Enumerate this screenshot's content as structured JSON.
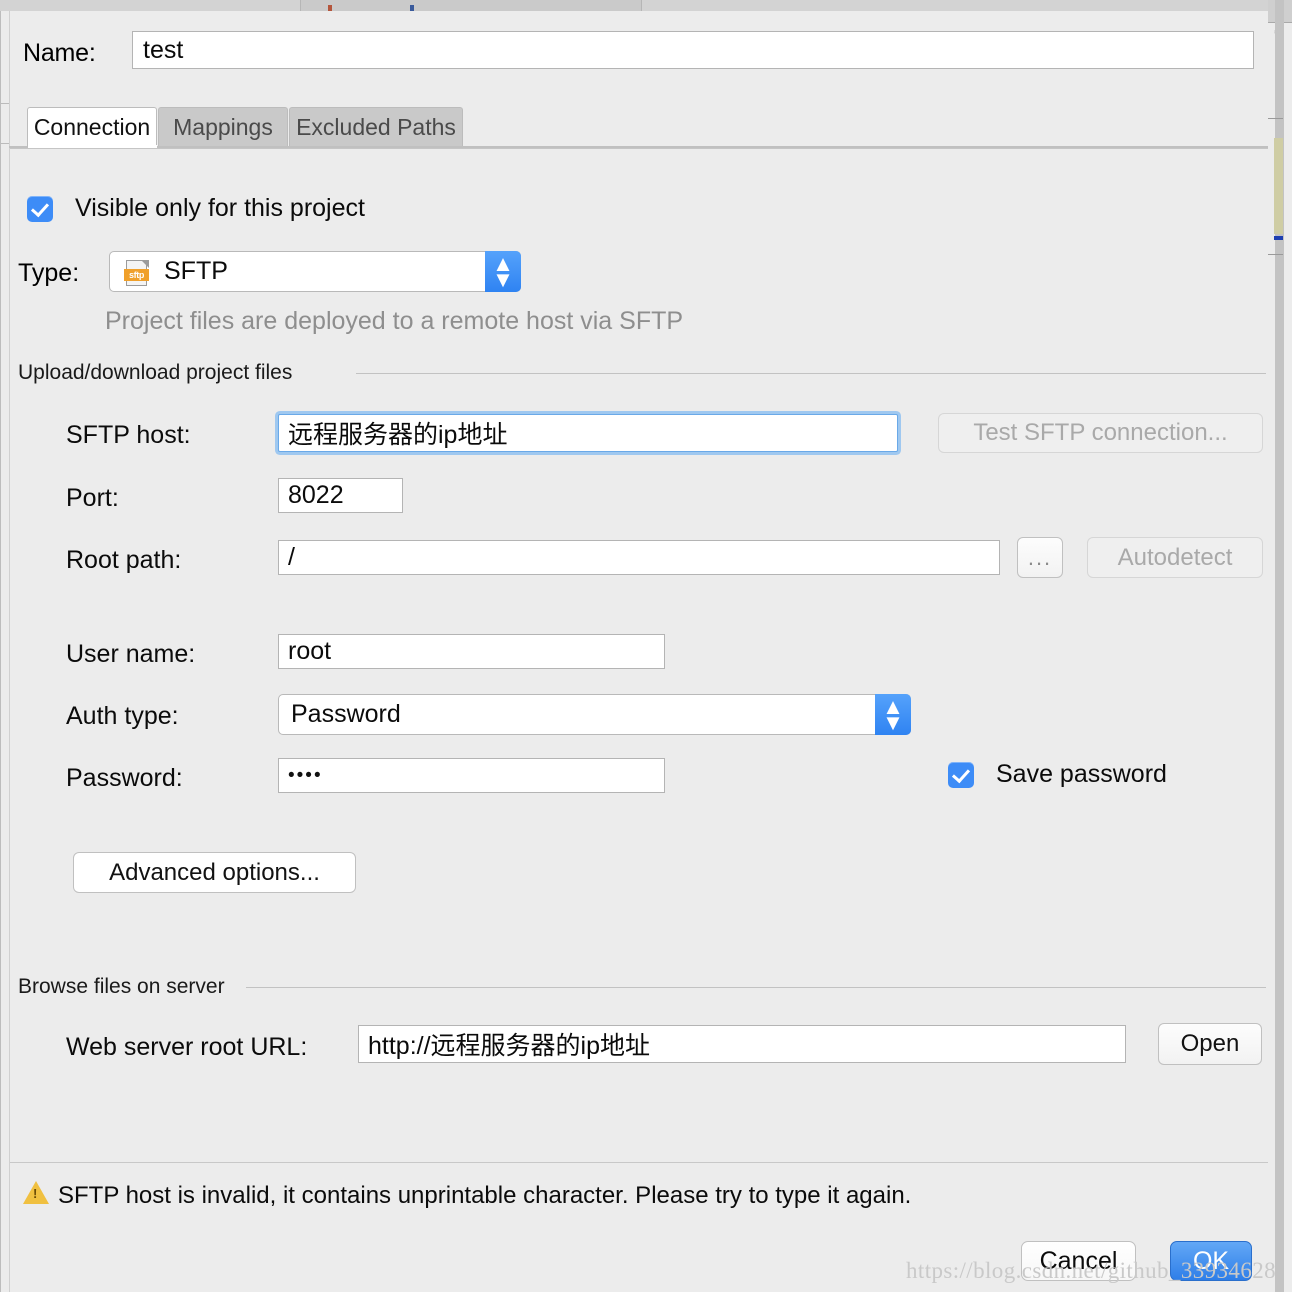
{
  "window": {
    "name_label": "Name:",
    "name_value": "test"
  },
  "tabs": [
    {
      "label": "Connection",
      "active": true
    },
    {
      "label": "Mappings",
      "active": false
    },
    {
      "label": "Excluded Paths",
      "active": false
    }
  ],
  "connection": {
    "visible_only_checkbox": {
      "label": "Visible only for this project",
      "checked": true
    },
    "type": {
      "label": "Type:",
      "value": "SFTP",
      "icon": "sftp-file-icon",
      "icon_text": "sftp",
      "hint": "Project files are deployed to a remote host via SFTP"
    },
    "upload_group": {
      "title": "Upload/download project files",
      "sftp_host": {
        "label": "SFTP host:",
        "value": "远程服务器的ip地址",
        "focused": true
      },
      "test_button": {
        "label": "Test SFTP connection...",
        "disabled": true
      },
      "port": {
        "label": "Port:",
        "value": "8022"
      },
      "root_path": {
        "label": "Root path:",
        "value": "/"
      },
      "browse_button": {
        "label": "..."
      },
      "autodetect_button": {
        "label": "Autodetect",
        "disabled": true
      },
      "user_name": {
        "label": "User name:",
        "value": "root"
      },
      "auth_type": {
        "label": "Auth type:",
        "value": "Password"
      },
      "password": {
        "label": "Password:",
        "value": "••••"
      },
      "save_password_checkbox": {
        "label": "Save password",
        "checked": true
      },
      "advanced_button": {
        "label": "Advanced options..."
      }
    },
    "browse_group": {
      "title": "Browse files on server",
      "web_url": {
        "label": "Web server root URL:",
        "value": "http://远程服务器的ip地址"
      },
      "open_button": {
        "label": "Open"
      }
    }
  },
  "warning": {
    "icon": "warning-triangle-icon",
    "message": "SFTP host is invalid, it contains unprintable character. Please try to type it again."
  },
  "footer": {
    "cancel_label": "Cancel",
    "ok_label": "OK"
  },
  "watermark": "https://blog.csdn.net/github_33934628",
  "colors": {
    "accent_blue": "#3d8cf7",
    "ok_blue": "#2e7ee8",
    "warning_yellow": "#f0c040",
    "dialog_bg": "#ececec",
    "disabled_text": "#a9a9a9",
    "focus_ring": "#9fc8f0",
    "sftp_tag_orange": "#f0a02a"
  }
}
